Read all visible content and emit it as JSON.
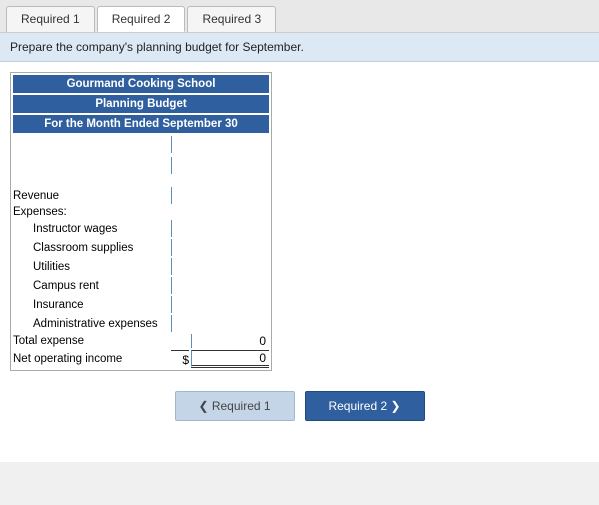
{
  "tabs": [
    {
      "label": "Required 1",
      "active": false
    },
    {
      "label": "Required 2",
      "active": true
    },
    {
      "label": "Required 3",
      "active": false
    }
  ],
  "instruction": "Prepare the company's planning budget for September.",
  "budget": {
    "title1": "Gourmand Cooking School",
    "title2": "Planning Budget",
    "title3": "For the Month Ended September 30",
    "rows": [
      {
        "label": "Revenue",
        "indented": false,
        "type": "data"
      },
      {
        "label": "Expenses:",
        "indented": false,
        "type": "label"
      },
      {
        "label": "Instructor wages",
        "indented": true,
        "type": "data"
      },
      {
        "label": "Classroom supplies",
        "indented": true,
        "type": "data"
      },
      {
        "label": "Utilities",
        "indented": true,
        "type": "data"
      },
      {
        "label": "Campus rent",
        "indented": true,
        "type": "data"
      },
      {
        "label": "Insurance",
        "indented": true,
        "type": "data"
      },
      {
        "label": "Administrative expenses",
        "indented": true,
        "type": "data"
      }
    ],
    "total_expense_label": "Total expense",
    "total_expense_value": "0",
    "net_income_label": "Net operating income",
    "net_income_dollar": "$",
    "net_income_value": "0"
  },
  "buttons": {
    "prev_label": "❮  Required 1",
    "next_label": "Required 2  ❯"
  }
}
